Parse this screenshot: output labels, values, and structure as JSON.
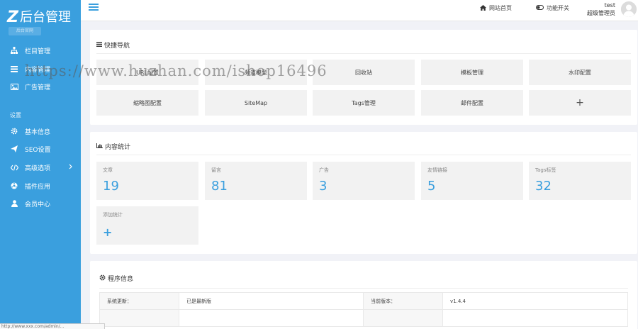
{
  "sidebar": {
    "logo_letter": "Z",
    "logo_text": "后台管理",
    "logo_badge": "后台官网",
    "items": [
      {
        "label": "栏目管理",
        "icon": "sitemap-icon"
      },
      {
        "label": "内容管理",
        "icon": "list-icon"
      },
      {
        "label": "广告管理",
        "icon": "image-icon"
      }
    ],
    "settings_title": "设置",
    "settings_items": [
      {
        "label": "基本信息",
        "icon": "gear-icon"
      },
      {
        "label": "SEO设置",
        "icon": "send-icon"
      },
      {
        "label": "高级选项",
        "icon": "code-icon"
      },
      {
        "label": "插件应用",
        "icon": "plugin-icon"
      },
      {
        "label": "会员中心",
        "icon": "user-icon"
      }
    ]
  },
  "header": {
    "home_link": "网站首页",
    "toggle_link": "功能开关",
    "user_name": "test",
    "user_role": "超级管理员"
  },
  "quick_nav": {
    "title": "快捷导航",
    "buttons": [
      "URL配置",
      "频道模型",
      "回收站",
      "模板管理",
      "水印配置",
      "缩略图配置",
      "SiteMap",
      "Tags管理",
      "邮件配置",
      "+"
    ]
  },
  "stats": {
    "title": "内容统计",
    "items": [
      {
        "label": "文章",
        "value": "19"
      },
      {
        "label": "留言",
        "value": "81"
      },
      {
        "label": "广告",
        "value": "3"
      },
      {
        "label": "友情链接",
        "value": "5"
      },
      {
        "label": "Tags标签",
        "value": "32"
      }
    ],
    "add_label": "添加统计",
    "add_symbol": "+"
  },
  "program_info": {
    "title": "程序信息",
    "rows": [
      {
        "label1": "系统更新：",
        "value1": "已是最新版",
        "label2": "当前版本：",
        "value2": "v1.4.4"
      }
    ]
  },
  "watermark": "https://www.huzhan.com/ishop16496",
  "status_bar": "http://www.xxx.com/admin/..."
}
